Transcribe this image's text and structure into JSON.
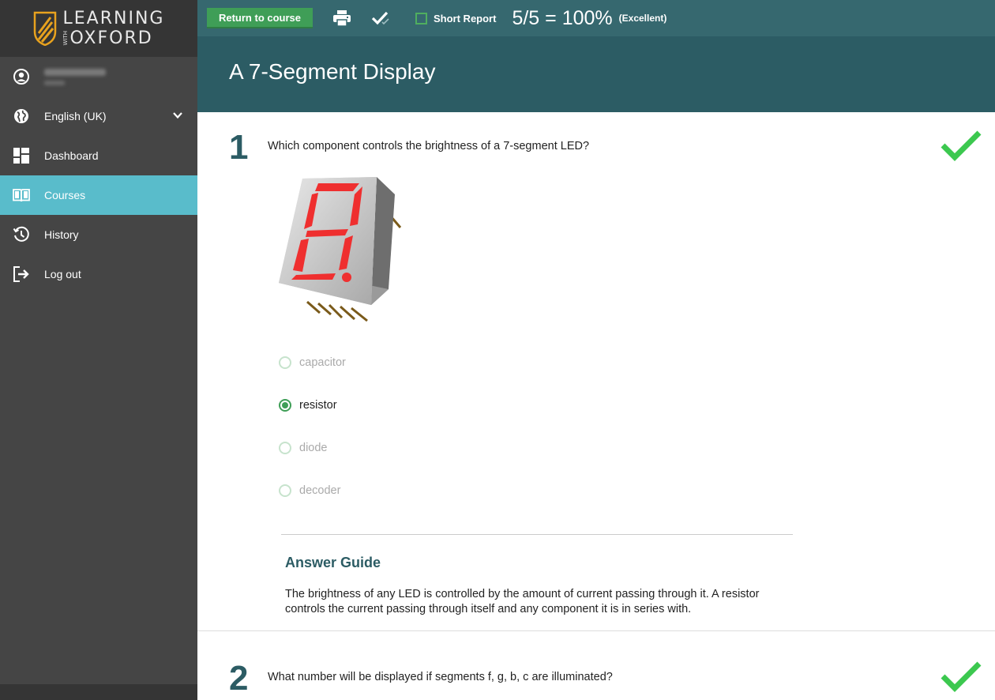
{
  "sidebar": {
    "brand": {
      "line1": "LEARNING",
      "with": "WITH",
      "line2": "OXFORD"
    },
    "user": {
      "name": "Stewart Mills",
      "role": "Self-Learner"
    },
    "language": "English (UK)",
    "items": [
      {
        "label": "Dashboard",
        "icon": "dashboard-icon"
      },
      {
        "label": "Courses",
        "icon": "book-icon",
        "active": true
      },
      {
        "label": "History",
        "icon": "history-icon"
      },
      {
        "label": "Log out",
        "icon": "logout-icon"
      }
    ]
  },
  "toolbar": {
    "return_label": "Return to course",
    "print_icon": "printer-icon",
    "check_icon": "double-check-icon",
    "short_report_label": "Short Report",
    "score": "5/5 = 100%",
    "score_note": "(Excellent)"
  },
  "page": {
    "title": "A 7-Segment Display"
  },
  "questions": [
    {
      "number": "1",
      "text": "Which component controls the brightness of a 7-segment LED?",
      "status": "correct",
      "options": [
        "capacitor",
        "resistor",
        "diode",
        "decoder"
      ],
      "selected": "resistor",
      "answer_guide": {
        "title": "Answer Guide",
        "text": "The brightness of any LED is controlled by the amount of current passing through it. A resistor controls the current passing through itself and any component it is in series with."
      }
    },
    {
      "number": "2",
      "text": "What number will be displayed if segments f, g, b, c are illuminated?",
      "status": "correct"
    }
  ],
  "colors": {
    "sidebar": "#454545",
    "active": "#59bccb",
    "topbar": "#36686f",
    "titlebar": "#2c5c64",
    "accent_green": "#3f9e57",
    "check_green": "#3cc84f"
  }
}
